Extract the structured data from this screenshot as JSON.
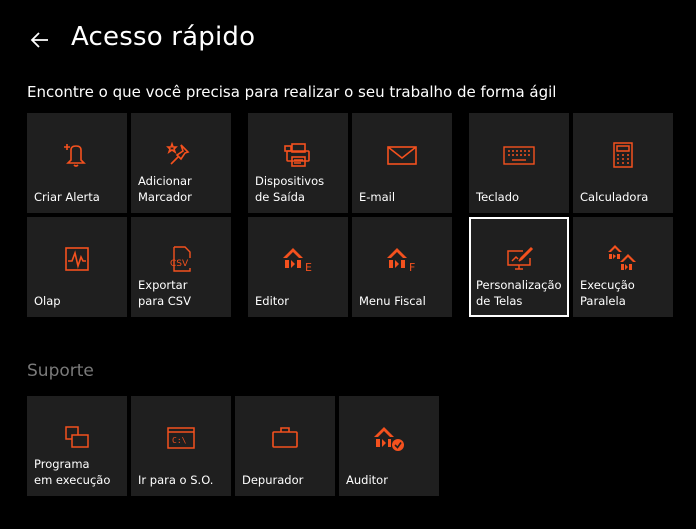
{
  "header": {
    "title": "Acesso rápido",
    "subtitle": "Encontre o que você precisa para realizar o seu trabalho de forma ágil"
  },
  "colors": {
    "accent": "#f4511e",
    "tile_bg": "#1f1f1f",
    "background": "#000000",
    "section_title": "#7a7a7a"
  },
  "tiles": [
    {
      "label": "Criar Alerta",
      "icon": "bell-alert-icon"
    },
    {
      "label": "Adicionar\nMarcador",
      "icon": "pin-star-icon"
    },
    {
      "label": "Dispositivos\nde Saída",
      "icon": "printer-icon"
    },
    {
      "label": "E-mail",
      "icon": "envelope-icon"
    },
    {
      "label": "Teclado",
      "icon": "keyboard-icon"
    },
    {
      "label": "Calculadora",
      "icon": "calculator-icon"
    },
    {
      "label": "Olap",
      "icon": "olap-chart-icon"
    },
    {
      "label": "Exportar\npara CSV",
      "icon": "csv-file-icon"
    },
    {
      "label": "Editor",
      "icon": "editor-logo-icon"
    },
    {
      "label": "Menu Fiscal",
      "icon": "fiscal-menu-logo-icon"
    },
    {
      "label": "Personalização\nde Telas",
      "icon": "monitor-brush-icon"
    },
    {
      "label": "Execução\nParalela",
      "icon": "parallel-execution-icon"
    }
  ],
  "support": {
    "title": "Suporte",
    "tiles": [
      {
        "label": "Programa\nem execução",
        "icon": "windows-stack-icon"
      },
      {
        "label": "Ir para o S.O.",
        "icon": "command-prompt-icon"
      },
      {
        "label": "Depurador",
        "icon": "briefcase-icon"
      },
      {
        "label": "Auditor",
        "icon": "auditor-logo-icon"
      }
    ]
  }
}
